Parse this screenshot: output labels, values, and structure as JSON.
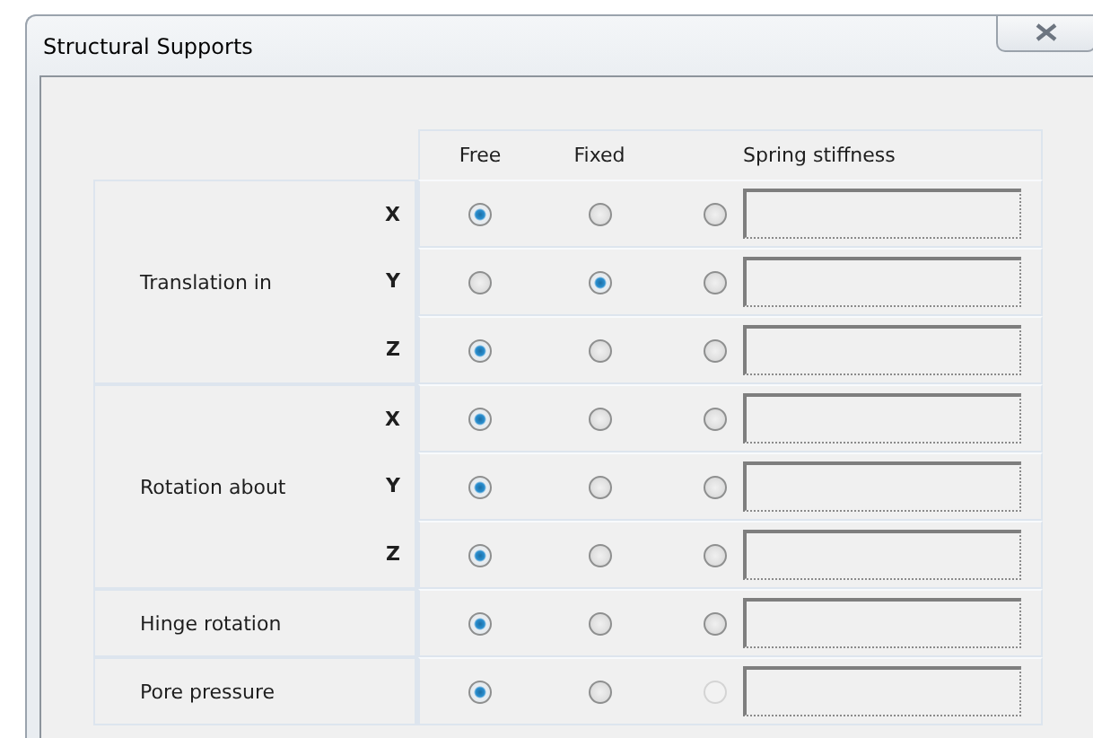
{
  "window": {
    "title": "Structural Supports"
  },
  "columns": [
    "Free",
    "Fixed",
    "Spring stiffness"
  ],
  "groups": [
    {
      "label": "Translation in",
      "rows": [
        {
          "axis": "X",
          "choices": [
            {
              "selected": true,
              "disabled": false
            },
            {
              "selected": false,
              "disabled": false
            },
            {
              "selected": false,
              "disabled": false
            }
          ]
        },
        {
          "axis": "Y",
          "choices": [
            {
              "selected": false,
              "disabled": false
            },
            {
              "selected": true,
              "disabled": false
            },
            {
              "selected": false,
              "disabled": false
            }
          ]
        },
        {
          "axis": "Z",
          "choices": [
            {
              "selected": true,
              "disabled": false
            },
            {
              "selected": false,
              "disabled": false
            },
            {
              "selected": false,
              "disabled": false
            }
          ]
        }
      ]
    },
    {
      "label": "Rotation about",
      "rows": [
        {
          "axis": "X",
          "choices": [
            {
              "selected": true,
              "disabled": false
            },
            {
              "selected": false,
              "disabled": false
            },
            {
              "selected": false,
              "disabled": false
            }
          ]
        },
        {
          "axis": "Y",
          "choices": [
            {
              "selected": true,
              "disabled": false
            },
            {
              "selected": false,
              "disabled": false
            },
            {
              "selected": false,
              "disabled": false
            }
          ]
        },
        {
          "axis": "Z",
          "choices": [
            {
              "selected": true,
              "disabled": false
            },
            {
              "selected": false,
              "disabled": false
            },
            {
              "selected": false,
              "disabled": false
            }
          ]
        }
      ]
    },
    {
      "label": "Hinge rotation",
      "rows": [
        {
          "choices": [
            {
              "selected": true,
              "disabled": false
            },
            {
              "selected": false,
              "disabled": false
            },
            {
              "selected": false,
              "disabled": false
            }
          ]
        }
      ]
    },
    {
      "label": "Pore pressure",
      "rows": [
        {
          "choices": [
            {
              "selected": true,
              "disabled": false
            },
            {
              "selected": false,
              "disabled": false
            },
            {
              "selected": false,
              "disabled": true
            }
          ]
        }
      ]
    }
  ]
}
